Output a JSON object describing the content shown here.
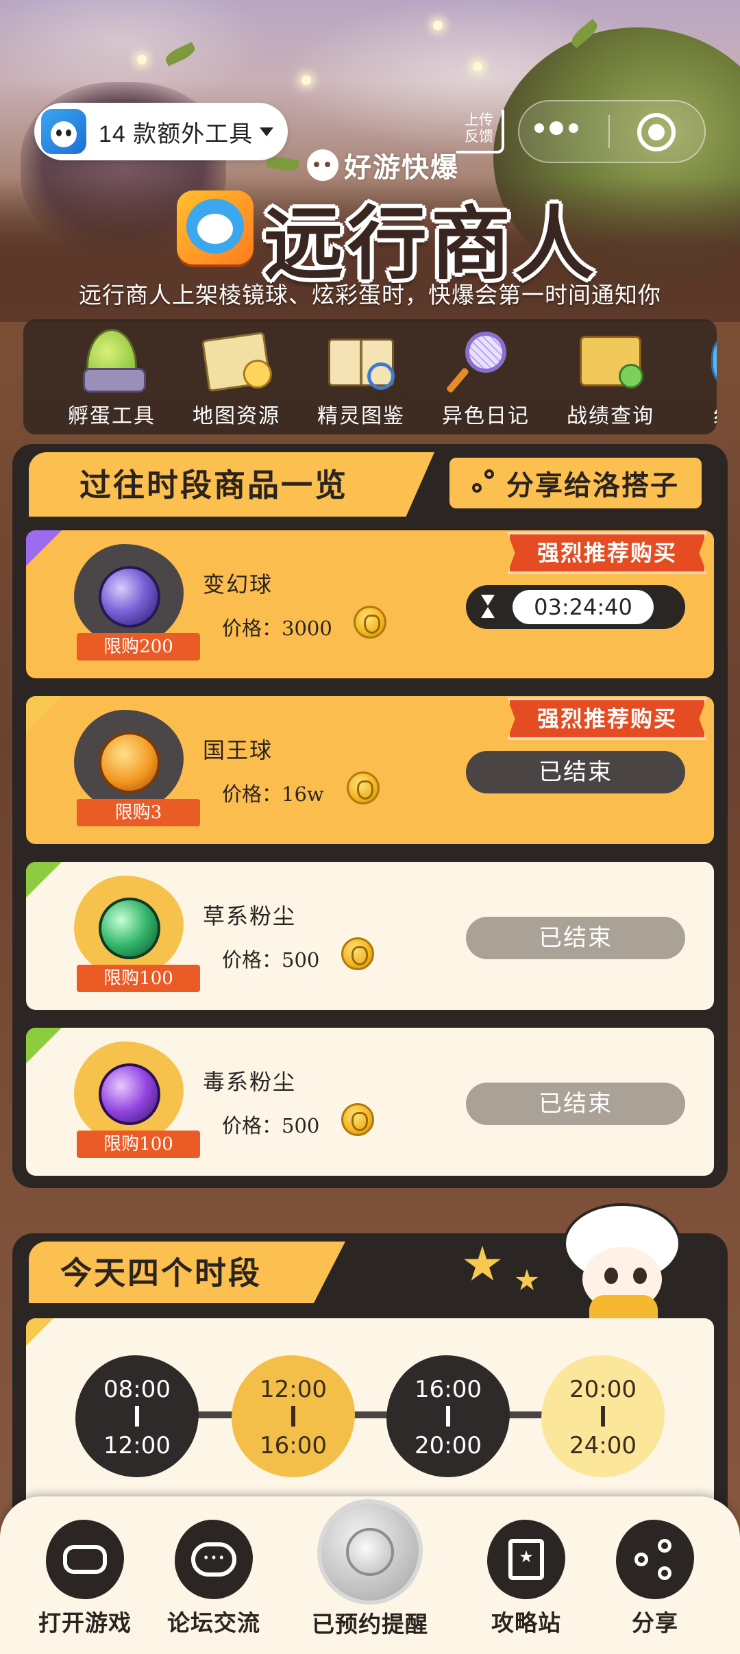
{
  "header": {
    "tool_label": "14 款额外工具",
    "feedback_line1": "上传",
    "feedback_line2": "反馈",
    "brand": "好游快爆",
    "title": "远行商人",
    "subtitle": "远行商人上架棱镜球、炫彩蛋时，快爆会第一时间通知你"
  },
  "tools": [
    {
      "label": "孵蛋工具",
      "icon": "egg-icon"
    },
    {
      "label": "地图资源",
      "icon": "map-icon"
    },
    {
      "label": "精灵图鉴",
      "icon": "book-icon"
    },
    {
      "label": "异色日记",
      "icon": "net-icon"
    },
    {
      "label": "战绩查询",
      "icon": "scroll-icon"
    },
    {
      "label": "组队",
      "icon": "pet-icon"
    }
  ],
  "past": {
    "title": "过往时段商品一览",
    "share_label": "分享给洛搭子",
    "recommend_label": "强烈推荐购买",
    "price_prefix": "价格：",
    "items": [
      {
        "name": "变幻球",
        "price": "3000",
        "limit": "限购200",
        "recommended": true,
        "status": "timer",
        "timer": "03:24:40"
      },
      {
        "name": "国王球",
        "price": "16w",
        "limit": "限购3",
        "recommended": true,
        "status": "已结束"
      },
      {
        "name": "草系粉尘",
        "price": "500",
        "limit": "限购100",
        "recommended": false,
        "status": "已结束"
      },
      {
        "name": "毒系粉尘",
        "price": "500",
        "limit": "限购100",
        "recommended": false,
        "status": "已结束"
      }
    ]
  },
  "today": {
    "title": "今天四个时段",
    "slots": [
      {
        "start": "08:00",
        "end": "12:00"
      },
      {
        "start": "12:00",
        "end": "16:00"
      },
      {
        "start": "16:00",
        "end": "20:00"
      },
      {
        "start": "20:00",
        "end": "24:00"
      }
    ]
  },
  "nav": [
    {
      "label": "打开游戏",
      "icon": "gamepad-icon"
    },
    {
      "label": "论坛交流",
      "icon": "chat-icon"
    },
    {
      "label": "已预约提醒",
      "icon": "reminder-icon"
    },
    {
      "label": "攻略站",
      "icon": "guide-book-icon"
    },
    {
      "label": "分享",
      "icon": "share-icon"
    }
  ],
  "colors": {
    "accent": "#fbc04f",
    "panel": "#2b2624",
    "recommend": "#e54c22",
    "limit": "#ea5b25"
  }
}
